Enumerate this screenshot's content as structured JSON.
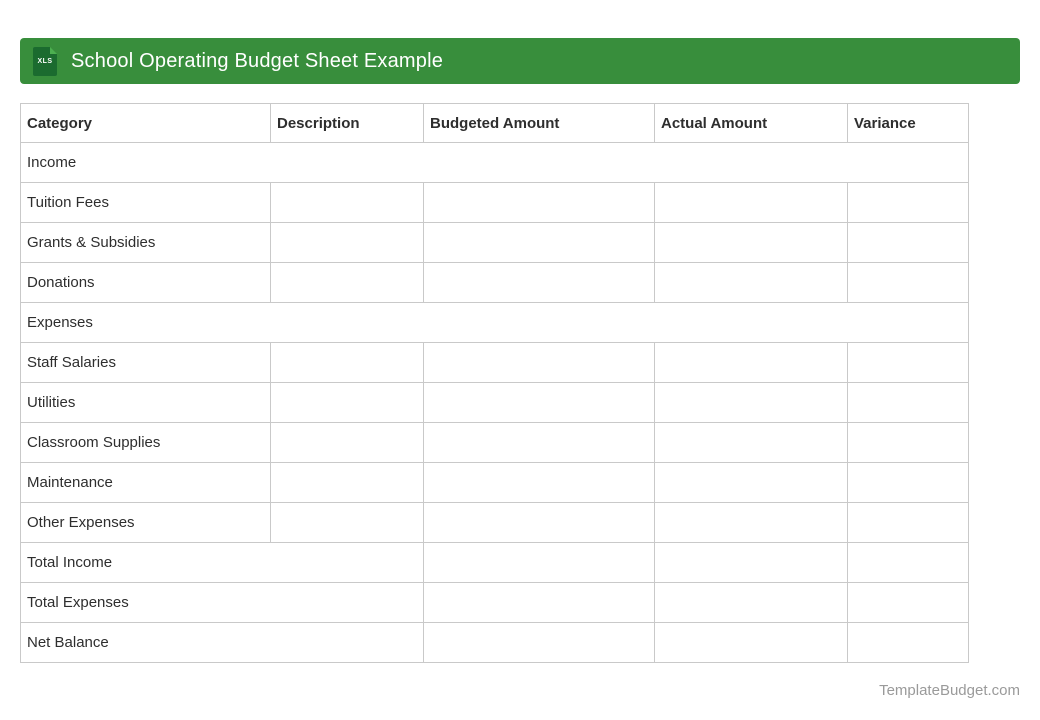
{
  "banner": {
    "icon_label": "XLS",
    "title": "School Operating Budget Sheet Example",
    "accent_color": "#388e3c"
  },
  "table": {
    "columns": [
      "Category",
      "Description",
      "Budgeted Amount",
      "Actual Amount",
      "Variance"
    ],
    "border_color": "#c9c9c9",
    "rows": [
      {
        "type": "section",
        "label": "Income"
      },
      {
        "type": "item",
        "label": "Tuition Fees"
      },
      {
        "type": "item",
        "label": "Grants & Subsidies"
      },
      {
        "type": "item",
        "label": "Donations"
      },
      {
        "type": "section",
        "label": "Expenses"
      },
      {
        "type": "item",
        "label": "Staff Salaries"
      },
      {
        "type": "item",
        "label": "Utilities"
      },
      {
        "type": "item",
        "label": "Classroom Supplies"
      },
      {
        "type": "item",
        "label": "Maintenance"
      },
      {
        "type": "item",
        "label": "Other Expenses"
      },
      {
        "type": "total",
        "label": "Total Income"
      },
      {
        "type": "total",
        "label": "Total Expenses"
      },
      {
        "type": "total",
        "label": "Net Balance"
      }
    ]
  },
  "footer": {
    "watermark": "TemplateBudget.com"
  }
}
